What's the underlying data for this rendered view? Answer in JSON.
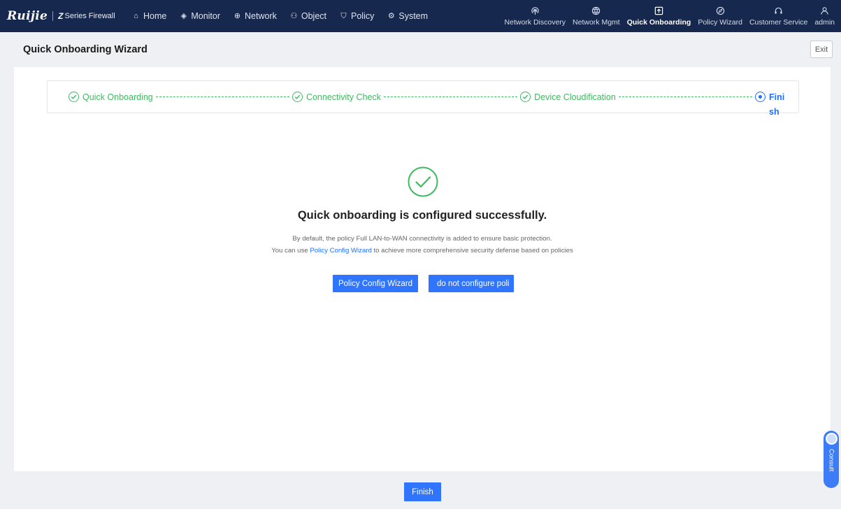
{
  "brand": {
    "logo": "Ruijie",
    "z": "Z",
    "product": "Series Firewall"
  },
  "nav": {
    "items": [
      {
        "label": "Home",
        "icon": "home-icon",
        "glyph": "⌂"
      },
      {
        "label": "Monitor",
        "icon": "monitor-icon",
        "glyph": "◈"
      },
      {
        "label": "Network",
        "icon": "network-icon",
        "glyph": "⊕"
      },
      {
        "label": "Object",
        "icon": "object-icon",
        "glyph": "⚇"
      },
      {
        "label": "Policy",
        "icon": "policy-icon",
        "glyph": "⛉"
      },
      {
        "label": "System",
        "icon": "system-icon",
        "glyph": "⚙"
      }
    ]
  },
  "right_nav": {
    "network_discovery": "Network Discovery",
    "network_mgmt": "Network Mgmt",
    "quick_onboarding": "Quick Onboarding",
    "policy_wizard": "Policy Wizard",
    "customer_service": "Customer Service",
    "admin": "admin"
  },
  "page": {
    "title": "Quick Onboarding Wizard",
    "exit_label": "Exit"
  },
  "steps": {
    "s1": "Quick Onboarding",
    "s2": "Connectivity Check",
    "s3": "Device Cloudification",
    "s4": "Finish"
  },
  "result": {
    "title": "Quick onboarding is configured successfully.",
    "line1": "By default, the policy Full LAN-to-WAN connectivity is added to ensure basic protection.",
    "line2_prefix": "You can use ",
    "line2_link": "Policy Config Wizard",
    "line2_suffix": " to achieve more comprehensive security defense based on policies",
    "wizard_button": "Policy Config Wizard",
    "skip_button": "do not configure poli"
  },
  "footer": {
    "finish_label": "Finish"
  },
  "consult": {
    "label": "Consult"
  },
  "colors": {
    "topbar": "#17284f",
    "success": "#3dbb5f",
    "primary": "#2f75ff"
  }
}
